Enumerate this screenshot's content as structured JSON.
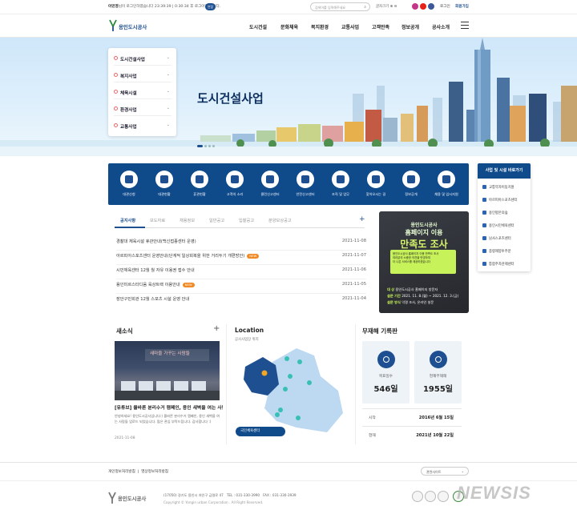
{
  "util": {
    "user_name": "이민영",
    "session_text": "님이 로그인하였습니다",
    "time_text": "23:39:39",
    "logout_notice": "0:30:34 후 로그아웃 됩니다.",
    "extend_button": "연장",
    "search_placeholder": "검색어를 입력해주세요",
    "font_size_label": "글자크기",
    "login_label": "로그인",
    "join_label": "회원가입",
    "sns": [
      {
        "name": "instagram-icon",
        "color": "#c13584"
      },
      {
        "name": "youtube-icon",
        "color": "#e62117"
      },
      {
        "name": "facebook-icon",
        "color": "#3b5998"
      },
      {
        "name": "blog-icon",
        "color": "#1d4f91"
      }
    ]
  },
  "gnb": {
    "logo_text": "용인도시공사",
    "items": [
      "도시건설",
      "문화체육",
      "복지환경",
      "교통사업",
      "고객만족",
      "정보공개",
      "공사소개"
    ]
  },
  "hero": {
    "title": "도시건설사업",
    "side_menu": [
      "도시건설사업",
      "복지사업",
      "체육시설",
      "환경사업",
      "교통사업"
    ]
  },
  "quick": {
    "items": [
      "대관신청",
      "대관현황",
      "휴관현황",
      "고객의 소리",
      "클린신고센터",
      "안전신고센터",
      "조직 및 업무",
      "찾아오시는 길",
      "정보공개",
      "채용 및 입시지원"
    ]
  },
  "right_panel": {
    "title": "사업 및 시설 바로가기",
    "items": [
      "교통약자이동지원",
      "아르피아스포츠센터",
      "용인평온의숲",
      "용인시민체육센터",
      "남사스포츠센터",
      "종량제봉투주문",
      "통합주차관제센터"
    ]
  },
  "board": {
    "tabs": [
      "공지사항",
      "보도자료",
      "채용정보",
      "입찰공고",
      "일반공고",
      "분양보상공고"
    ],
    "notices": [
      {
        "title": "경찰대 체육시설 휴관안내(백신접종센터 운영)",
        "date": "2021-11-08",
        "new": ""
      },
      {
        "title": "아르피아스포츠센터 운영안내(단계적 일상회복을 위한 거리두기 개편방안)",
        "date": "2021-11-07",
        "new": "NEW"
      },
      {
        "title": "시민체육센터 12월 월 자유 이용권 접수 안내",
        "date": "2021-11-06",
        "new": ""
      },
      {
        "title": "용인미르스타디움 육상트랙 이용안내",
        "date": "2021-11-05",
        "new": "NEW"
      },
      {
        "title": "장안구민회관 12월 스포츠 시설 운영 안내",
        "date": "2021-11-04",
        "new": ""
      }
    ]
  },
  "banner": {
    "line1": "용인도시공사",
    "line2": "홈페이지 이용",
    "line3": "만족도 조사",
    "phone_lines": [
      "용인도시공사 홈페이지 이용 만족도 조사",
      "여러분의 소중한 의견을 반영하여",
      "더 나은 서비스를 제공하겠습니다"
    ],
    "target_label": "대    상",
    "target_value": "용인도시공사 홈페이지 방문자",
    "period_label": "설문 기간",
    "period_value": "2021. 11. 8.(월) ~ 2021. 12. 3.(금)",
    "method_label": "설문 방식",
    "method_value": "익명 조사, 온라인 설문"
  },
  "news": {
    "title": "새소식",
    "image_caption": "새마을 가꾸는 사람들",
    "headline": "[유튜브] 올바른 분리수거 캠페인, 용인 새벽을 여는 사람들",
    "body": "안녕하세요! 용인도시공사입니다:) 올바른 분리수거 캠페인, 용인 새벽을 여는 사람들 업로드 되었습니다. 많은 관심 부탁드립니다. 감사합니다 :)",
    "date": "2021-11-08"
  },
  "location": {
    "title": "Location",
    "subtitle": "공사사업장 위치",
    "button": "국민체육센터"
  },
  "safety": {
    "title": "무재해 기록판",
    "target_label": "목표일수",
    "target_value": "546일",
    "current_label": "현재무재해",
    "current_value": "1955일",
    "start_label": "시작",
    "start_value": "2016년 6월 15일",
    "now_label": "현재",
    "now_value": "2021년 10월 22일"
  },
  "footer": {
    "links": [
      "개인정보처리방침",
      "영상정보처리방침"
    ],
    "related_sites": "관련사이트",
    "logo_text": "용인도시공사",
    "address": "(17050) 경기도 용인시 처인구 금령로 47",
    "tel": "TEL : 031-330-3990",
    "fax": "FAX : 031-330-3939",
    "copyright": "Copyright © Yongin urban Corporation . All Right Reserved.",
    "watermark": "NEWSIS"
  },
  "colors": {
    "primary": "#0f4a8b",
    "accent": "#1d4f91",
    "new_badge": "#f08a24"
  }
}
